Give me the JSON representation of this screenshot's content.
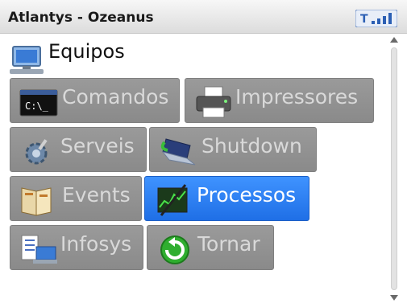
{
  "window": {
    "title": "Atlantys - Ozeanus"
  },
  "status": {
    "signal_icon": "signal-strength-icon",
    "signal_letter": "T"
  },
  "header": {
    "label": "Equipos",
    "icon": "computer-icon"
  },
  "buttons": [
    {
      "label": "Comandos",
      "icon": "command-prompt-icon",
      "selected": false
    },
    {
      "label": "Impressores",
      "icon": "printer-icon",
      "selected": false
    },
    {
      "label": "Serveis",
      "icon": "settings-gear-icon",
      "selected": false
    },
    {
      "label": "Shutdown",
      "icon": "shutdown-laptop-icon",
      "selected": false
    },
    {
      "label": "Events",
      "icon": "event-log-book-icon",
      "selected": false
    },
    {
      "label": "Processos",
      "icon": "task-manager-icon",
      "selected": true
    },
    {
      "label": "Infosys",
      "icon": "system-info-icon",
      "selected": false
    },
    {
      "label": "Tornar",
      "icon": "back-arrow-icon",
      "selected": false
    }
  ],
  "colors": {
    "accent": "#2f7ff5",
    "button": "#8f8f8f",
    "button_text": "#d9d9d9"
  }
}
